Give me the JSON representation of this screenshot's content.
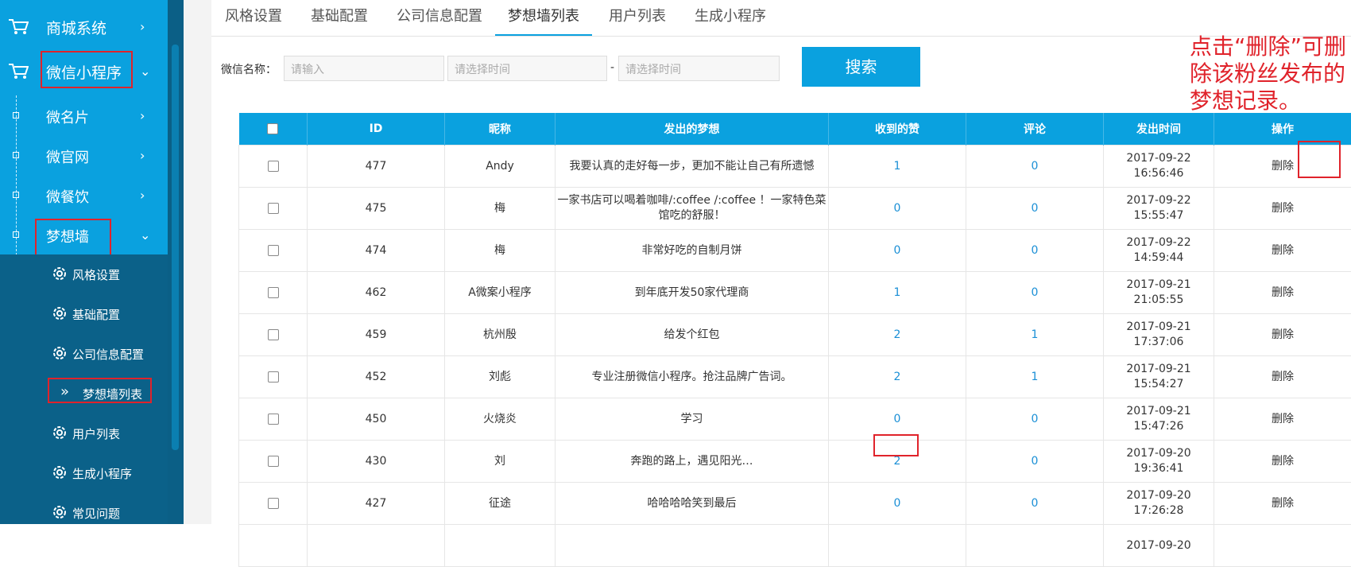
{
  "sidebar": {
    "top_menu": [
      {
        "label": "商城系统",
        "chevron": "›"
      },
      {
        "label": "微信小程序",
        "chevron": "⌄"
      }
    ],
    "sub_menu": [
      {
        "label": "微名片",
        "chevron": "›"
      },
      {
        "label": "微官网",
        "chevron": "›"
      },
      {
        "label": "微餐饮",
        "chevron": "›"
      },
      {
        "label": "梦想墙",
        "chevron": "⌄"
      }
    ],
    "subsub_menu": [
      {
        "label": "风格设置",
        "icon": "gear-icon"
      },
      {
        "label": "基础配置",
        "icon": "gear-icon"
      },
      {
        "label": "公司信息配置",
        "icon": "gear-icon"
      },
      {
        "label": "梦想墙列表",
        "icon": "double-chevron-icon"
      },
      {
        "label": "用户列表",
        "icon": "gear-icon"
      },
      {
        "label": "生成小程序",
        "icon": "gear-icon"
      },
      {
        "label": "常见问题",
        "icon": "gear-icon"
      }
    ],
    "double_chevron": "»"
  },
  "tabs": [
    {
      "label": "风格设置"
    },
    {
      "label": "基础配置"
    },
    {
      "label": "公司信息配置"
    },
    {
      "label": "梦想墙列表",
      "active": true
    },
    {
      "label": "用户列表"
    },
    {
      "label": "生成小程序"
    }
  ],
  "filter": {
    "label": "微信名称：",
    "name_placeholder": "请输入",
    "start_placeholder": "请选择时间",
    "dash": "-",
    "end_placeholder": "请选择时间",
    "search_label": "搜索"
  },
  "annotation": "点击“删除”可删除该粉丝发布的梦想记录。",
  "table": {
    "headers": [
      "",
      "ID",
      "昵称",
      "发出的梦想",
      "收到的赞",
      "评论",
      "发出时间",
      "操作"
    ],
    "rows": [
      {
        "id": "477",
        "nick": "Andy",
        "dream": "我要认真的走好每一步，更加不能让自己有所遗憾",
        "likes": "1",
        "comments": "0",
        "date": "2017-09-22",
        "time": "16:56:46",
        "op": "删除"
      },
      {
        "id": "475",
        "nick": "梅",
        "dream": "一家书店可以喝着咖啡/:coffee /:coffee ！一家特色菜馆吃的舒服！",
        "likes": "0",
        "comments": "0",
        "date": "2017-09-22",
        "time": "15:55:47",
        "op": "删除"
      },
      {
        "id": "474",
        "nick": "梅",
        "dream": "非常好吃的自制月饼",
        "likes": "0",
        "comments": "0",
        "date": "2017-09-22",
        "time": "14:59:44",
        "op": "删除"
      },
      {
        "id": "462",
        "nick": "A微案小程序",
        "dream": "到年底开发50家代理商",
        "likes": "1",
        "comments": "0",
        "date": "2017-09-21",
        "time": "21:05:55",
        "op": "删除"
      },
      {
        "id": "459",
        "nick": "杭州殷",
        "dream": "给发个红包",
        "likes": "2",
        "comments": "1",
        "date": "2017-09-21",
        "time": "17:37:06",
        "op": "删除"
      },
      {
        "id": "452",
        "nick": "刘彪",
        "dream": "专业注册微信小程序。抢注品牌广告词。",
        "likes": "2",
        "comments": "1",
        "date": "2017-09-21",
        "time": "15:54:27",
        "op": "删除"
      },
      {
        "id": "450",
        "nick": "火烧炎",
        "dream": "学习",
        "likes": "0",
        "comments": "0",
        "date": "2017-09-21",
        "time": "15:47:26",
        "op": "删除"
      },
      {
        "id": "430",
        "nick": "刘",
        "dream": "奔跑的路上，遇见阳光…",
        "likes": "2",
        "comments": "0",
        "date": "2017-09-20",
        "time": "19:36:41",
        "op": "删除"
      },
      {
        "id": "427",
        "nick": "征途",
        "dream": "哈哈哈哈笑到最后",
        "likes": "0",
        "comments": "0",
        "date": "2017-09-20",
        "time": "17:26:28",
        "op": "删除"
      },
      {
        "id": "",
        "nick": "",
        "dream": "",
        "likes": "",
        "comments": "",
        "date": "2017-09-20",
        "time": "",
        "op": ""
      }
    ]
  },
  "colors": {
    "accent": "#0aa1df",
    "sidebar_dark": "#0b6189",
    "annotation_red": "#e0232b",
    "link_blue": "#1a8fd6"
  }
}
